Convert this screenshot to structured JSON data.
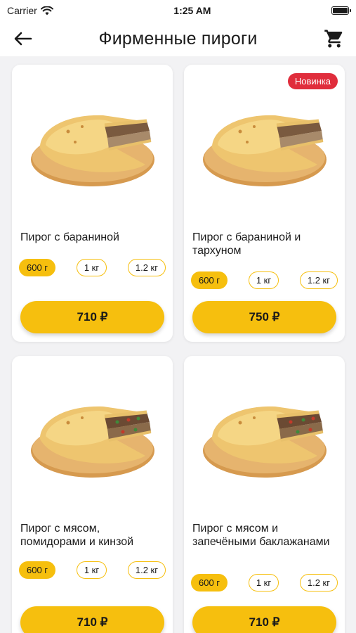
{
  "status_bar": {
    "carrier": "Carrier",
    "time": "1:25 AM"
  },
  "navbar": {
    "title": "Фирменные пироги",
    "back_icon": "arrow-left-icon",
    "cart_icon": "cart-icon"
  },
  "products": [
    {
      "name": "Пирог с бараниной",
      "sizes": [
        "600 г",
        "1 кг",
        "1.2 кг"
      ],
      "selected": "600 г",
      "price": "710 ₽",
      "badge": "",
      "filling": "meat"
    },
    {
      "name": "Пирог с бараниной и тархуном",
      "sizes": [
        "600 г",
        "1 кг",
        "1.2 кг"
      ],
      "selected": "600 г",
      "price": "750 ₽",
      "badge": "Новинка",
      "filling": "meat"
    },
    {
      "name": "Пирог с мясом, помидорами и кинзой",
      "sizes": [
        "600 г",
        "1 кг",
        "1.2 кг"
      ],
      "selected": "600 г",
      "price": "710 ₽",
      "badge": "",
      "filling": "veg"
    },
    {
      "name": "Пирог с мясом и запечёными баклажанами",
      "sizes": [
        "600 г",
        "1 кг",
        "1.2 кг"
      ],
      "selected": "600 г",
      "price": "710 ₽",
      "badge": "",
      "filling": "veg"
    }
  ],
  "colors": {
    "accent": "#f6bf0e",
    "badge": "#e02d3c",
    "background": "#f2f2f4"
  }
}
